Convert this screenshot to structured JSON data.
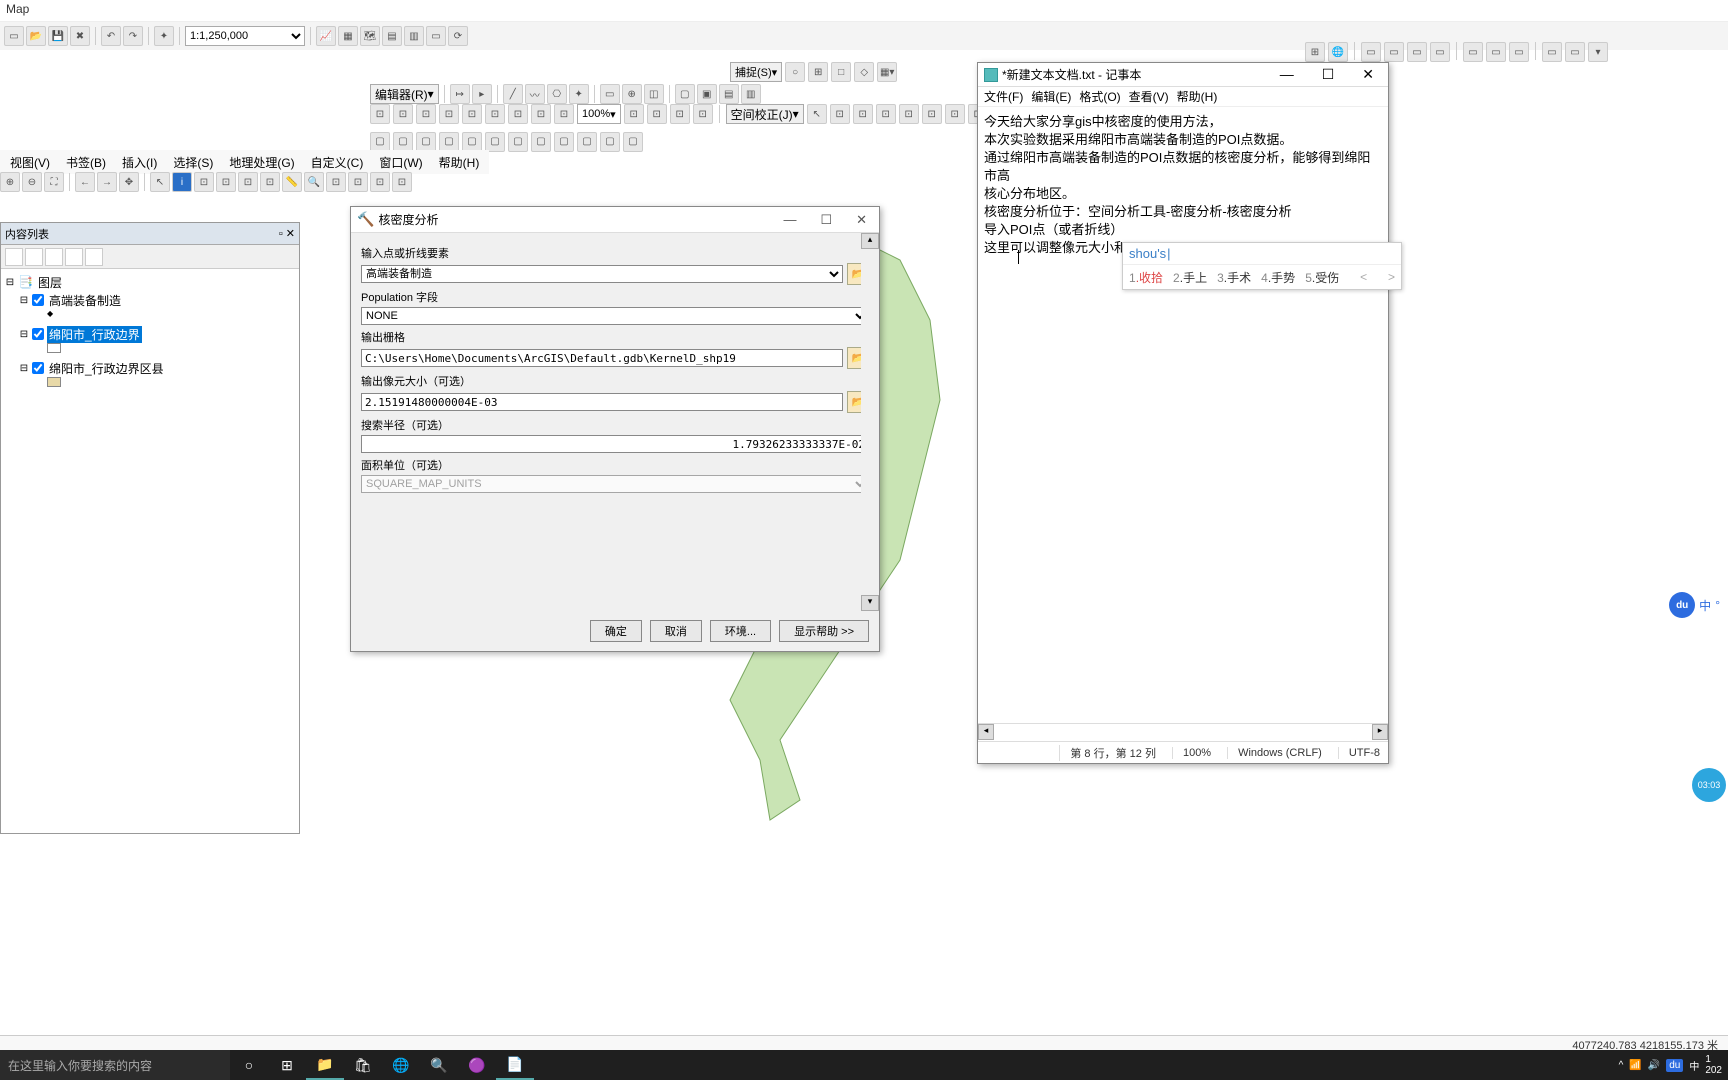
{
  "app": {
    "title": "Map"
  },
  "scale": "1:1,250,000",
  "menu": [
    "视图(V)",
    "书签(B)",
    "插入(I)",
    "选择(S)",
    "地理处理(G)",
    "自定义(C)",
    "窗口(W)",
    "帮助(H)"
  ],
  "editor_label": "编辑器(R)",
  "snap_label": "捕捉(S)",
  "percent": "100%",
  "space_adjust": "空间校正(J)",
  "toc": {
    "title": "内容列表",
    "root": "图层",
    "items": [
      {
        "label": "高端装备制造",
        "checked": true,
        "selected": false,
        "sym_color": "#333",
        "sym_shape": "dot"
      },
      {
        "label": "绵阳市_行政边界",
        "checked": true,
        "selected": true,
        "sym_color": "#fff",
        "sym_shape": "box"
      },
      {
        "label": "绵阳市_行政边界区县",
        "checked": true,
        "selected": false,
        "sym_color": "#e8d9a8",
        "sym_shape": "box"
      }
    ]
  },
  "dialog": {
    "title": "核密度分析",
    "labels": {
      "input": "输入点或折线要素",
      "pop": "Population 字段",
      "outraster": "输出栅格",
      "cellsize": "输出像元大小（可选）",
      "radius": "搜索半径（可选）",
      "area": "面积单位（可选）"
    },
    "values": {
      "input": "高端装备制造",
      "pop": "NONE",
      "outraster": "C:\\Users\\Home\\Documents\\ArcGIS\\Default.gdb\\KernelD_shp19",
      "cellsize": "2.15191480000004E-03",
      "radius": "1.79326233333337E-02",
      "area": "SQUARE_MAP_UNITS"
    },
    "buttons": {
      "ok": "确定",
      "cancel": "取消",
      "env": "环境...",
      "help": "显示帮助 >>"
    }
  },
  "notepad": {
    "title": "*新建文本文档.txt - 记事本",
    "menu": [
      "文件(F)",
      "编辑(E)",
      "格式(O)",
      "查看(V)",
      "帮助(H)"
    ],
    "lines": [
      "今天给大家分享gis中核密度的使用方法，",
      "本次实验数据采用绵阳市高端装备制造的POI点数据。",
      "通过绵阳市高端装备制造的POI点数据的核密度分析，能够得到绵阳市高",
      "核心分布地区。",
      "核密度分析位于：空间分析工具-密度分析-核密度分析",
      "导入POI点（或者折线）",
      "这里可以调整像元大小和"
    ],
    "status": {
      "pos": "第 8 行，第 12 列",
      "zoom": "100%",
      "eol": "Windows (CRLF)",
      "enc": "UTF-8"
    }
  },
  "ime": {
    "composition": "shou's",
    "candidates": [
      {
        "n": "1",
        "w": "收拾"
      },
      {
        "n": "2",
        "w": "手上"
      },
      {
        "n": "3",
        "w": "手术"
      },
      {
        "n": "4",
        "w": "手势"
      },
      {
        "n": "5",
        "w": "受伤"
      }
    ]
  },
  "baidu": {
    "lang": "中"
  },
  "clock_bubble": "03:03",
  "coords": "4077240.783 4218155.173 米",
  "taskbar": {
    "search_placeholder": "在这里输入你要搜索的内容"
  },
  "tray": {
    "time": "1",
    "date": "202"
  }
}
